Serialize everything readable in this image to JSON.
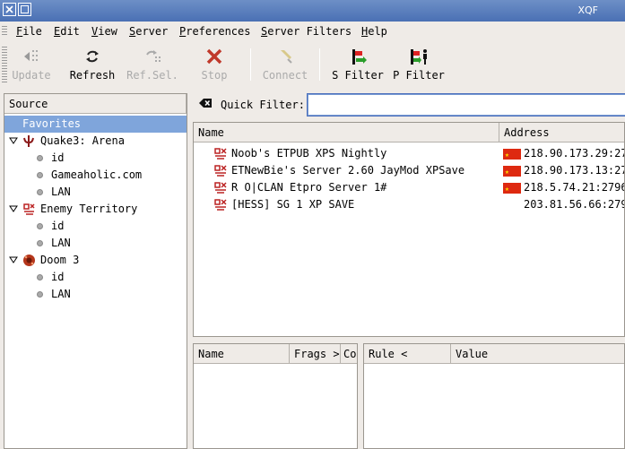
{
  "window": {
    "title": "XQF"
  },
  "menu": [
    {
      "label": "File",
      "mnemonic": "F",
      "rest": "ile"
    },
    {
      "label": "Edit",
      "mnemonic": "E",
      "rest": "dit"
    },
    {
      "label": "View",
      "mnemonic": "V",
      "rest": "iew"
    },
    {
      "label": "Server",
      "mnemonic": "S",
      "rest": "erver"
    },
    {
      "label": "Preferences",
      "mnemonic": "P",
      "rest": "references"
    },
    {
      "label": "Server Filters",
      "mnemonic": "S",
      "rest": "erver Filters"
    },
    {
      "label": "Help",
      "mnemonic": "H",
      "rest": "elp"
    }
  ],
  "toolbar": {
    "update": "Update",
    "refresh": "Refresh",
    "refsel": "Ref.Sel.",
    "stop": "Stop",
    "connect": "Connect",
    "sfilter": "S Filter",
    "pfilter": "P Filter"
  },
  "source": {
    "header": "Source",
    "favorites": "Favorites",
    "games": [
      {
        "name": "Quake3: Arena",
        "children": [
          "id",
          "Gameaholic.com",
          "LAN"
        ]
      },
      {
        "name": "Enemy Territory",
        "children": [
          "id",
          "LAN"
        ]
      },
      {
        "name": "Doom 3",
        "children": [
          "id",
          "LAN"
        ]
      }
    ]
  },
  "quick_filter": {
    "label": "Quick Filter:",
    "value": ""
  },
  "servers": {
    "columns": [
      "Name",
      "Address"
    ],
    "rows": [
      {
        "name": "Noob's ETPUB XPS Nightly",
        "address": "218.90.173.29:27",
        "flag": true
      },
      {
        "name": "ETNewBie's Server 2.60 JayMod XPSave",
        "address": "218.90.173.13:27",
        "flag": true
      },
      {
        "name": "R O|CLAN Etpro Server 1#",
        "address": "218.5.74.21:2796",
        "flag": true
      },
      {
        "name": "[HESS] SG 1 XP SAVE",
        "address": "203.81.56.66:279",
        "flag": false
      }
    ]
  },
  "players": {
    "columns": [
      "Name",
      "Frags >",
      "Co"
    ]
  },
  "rules": {
    "columns": [
      "Rule <",
      "Value"
    ]
  },
  "colors": {
    "titlebar": "#4a70b4",
    "selection": "#7fa5db",
    "flag": "#de2910",
    "stop": "#c0392b"
  }
}
